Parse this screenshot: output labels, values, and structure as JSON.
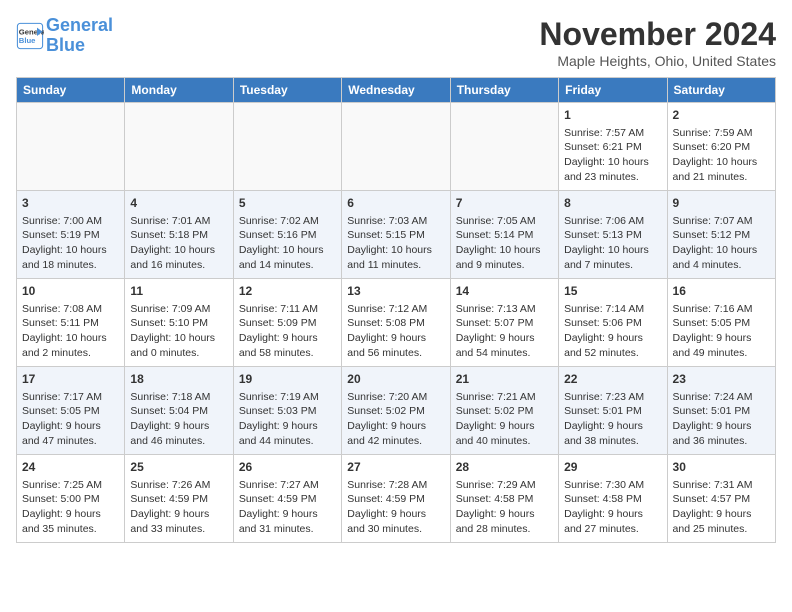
{
  "header": {
    "logo_line1": "General",
    "logo_line2": "Blue",
    "month": "November 2024",
    "location": "Maple Heights, Ohio, United States"
  },
  "weekdays": [
    "Sunday",
    "Monday",
    "Tuesday",
    "Wednesday",
    "Thursday",
    "Friday",
    "Saturday"
  ],
  "weeks": [
    [
      {
        "day": "",
        "text": ""
      },
      {
        "day": "",
        "text": ""
      },
      {
        "day": "",
        "text": ""
      },
      {
        "day": "",
        "text": ""
      },
      {
        "day": "",
        "text": ""
      },
      {
        "day": "1",
        "text": "Sunrise: 7:57 AM\nSunset: 6:21 PM\nDaylight: 10 hours and 23 minutes."
      },
      {
        "day": "2",
        "text": "Sunrise: 7:59 AM\nSunset: 6:20 PM\nDaylight: 10 hours and 21 minutes."
      }
    ],
    [
      {
        "day": "3",
        "text": "Sunrise: 7:00 AM\nSunset: 5:19 PM\nDaylight: 10 hours and 18 minutes."
      },
      {
        "day": "4",
        "text": "Sunrise: 7:01 AM\nSunset: 5:18 PM\nDaylight: 10 hours and 16 minutes."
      },
      {
        "day": "5",
        "text": "Sunrise: 7:02 AM\nSunset: 5:16 PM\nDaylight: 10 hours and 14 minutes."
      },
      {
        "day": "6",
        "text": "Sunrise: 7:03 AM\nSunset: 5:15 PM\nDaylight: 10 hours and 11 minutes."
      },
      {
        "day": "7",
        "text": "Sunrise: 7:05 AM\nSunset: 5:14 PM\nDaylight: 10 hours and 9 minutes."
      },
      {
        "day": "8",
        "text": "Sunrise: 7:06 AM\nSunset: 5:13 PM\nDaylight: 10 hours and 7 minutes."
      },
      {
        "day": "9",
        "text": "Sunrise: 7:07 AM\nSunset: 5:12 PM\nDaylight: 10 hours and 4 minutes."
      }
    ],
    [
      {
        "day": "10",
        "text": "Sunrise: 7:08 AM\nSunset: 5:11 PM\nDaylight: 10 hours and 2 minutes."
      },
      {
        "day": "11",
        "text": "Sunrise: 7:09 AM\nSunset: 5:10 PM\nDaylight: 10 hours and 0 minutes."
      },
      {
        "day": "12",
        "text": "Sunrise: 7:11 AM\nSunset: 5:09 PM\nDaylight: 9 hours and 58 minutes."
      },
      {
        "day": "13",
        "text": "Sunrise: 7:12 AM\nSunset: 5:08 PM\nDaylight: 9 hours and 56 minutes."
      },
      {
        "day": "14",
        "text": "Sunrise: 7:13 AM\nSunset: 5:07 PM\nDaylight: 9 hours and 54 minutes."
      },
      {
        "day": "15",
        "text": "Sunrise: 7:14 AM\nSunset: 5:06 PM\nDaylight: 9 hours and 52 minutes."
      },
      {
        "day": "16",
        "text": "Sunrise: 7:16 AM\nSunset: 5:05 PM\nDaylight: 9 hours and 49 minutes."
      }
    ],
    [
      {
        "day": "17",
        "text": "Sunrise: 7:17 AM\nSunset: 5:05 PM\nDaylight: 9 hours and 47 minutes."
      },
      {
        "day": "18",
        "text": "Sunrise: 7:18 AM\nSunset: 5:04 PM\nDaylight: 9 hours and 46 minutes."
      },
      {
        "day": "19",
        "text": "Sunrise: 7:19 AM\nSunset: 5:03 PM\nDaylight: 9 hours and 44 minutes."
      },
      {
        "day": "20",
        "text": "Sunrise: 7:20 AM\nSunset: 5:02 PM\nDaylight: 9 hours and 42 minutes."
      },
      {
        "day": "21",
        "text": "Sunrise: 7:21 AM\nSunset: 5:02 PM\nDaylight: 9 hours and 40 minutes."
      },
      {
        "day": "22",
        "text": "Sunrise: 7:23 AM\nSunset: 5:01 PM\nDaylight: 9 hours and 38 minutes."
      },
      {
        "day": "23",
        "text": "Sunrise: 7:24 AM\nSunset: 5:01 PM\nDaylight: 9 hours and 36 minutes."
      }
    ],
    [
      {
        "day": "24",
        "text": "Sunrise: 7:25 AM\nSunset: 5:00 PM\nDaylight: 9 hours and 35 minutes."
      },
      {
        "day": "25",
        "text": "Sunrise: 7:26 AM\nSunset: 4:59 PM\nDaylight: 9 hours and 33 minutes."
      },
      {
        "day": "26",
        "text": "Sunrise: 7:27 AM\nSunset: 4:59 PM\nDaylight: 9 hours and 31 minutes."
      },
      {
        "day": "27",
        "text": "Sunrise: 7:28 AM\nSunset: 4:59 PM\nDaylight: 9 hours and 30 minutes."
      },
      {
        "day": "28",
        "text": "Sunrise: 7:29 AM\nSunset: 4:58 PM\nDaylight: 9 hours and 28 minutes."
      },
      {
        "day": "29",
        "text": "Sunrise: 7:30 AM\nSunset: 4:58 PM\nDaylight: 9 hours and 27 minutes."
      },
      {
        "day": "30",
        "text": "Sunrise: 7:31 AM\nSunset: 4:57 PM\nDaylight: 9 hours and 25 minutes."
      }
    ]
  ]
}
